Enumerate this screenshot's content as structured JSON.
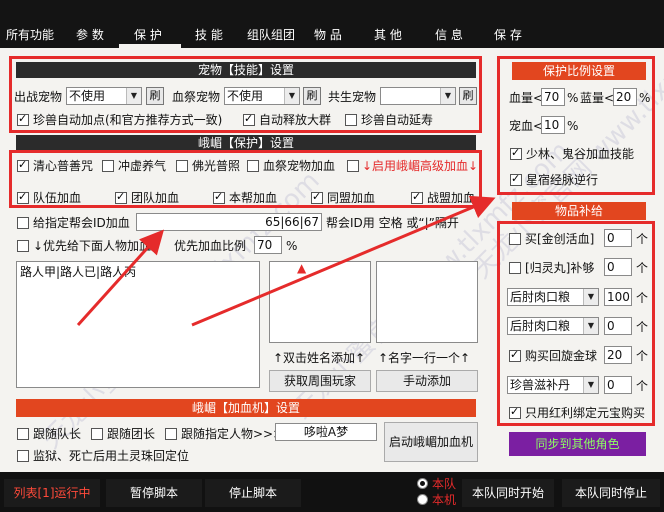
{
  "tabs": [
    "所有功能",
    "参 数",
    "保 护",
    "技 能",
    "组队组团",
    "物 品",
    "其 他",
    "信 息",
    "保 存"
  ],
  "pet": {
    "header": "宠物【技能】设置",
    "out_pet_label": "出战宠物",
    "out_pet_value": "不使用",
    "blood_pet_label": "血祭宠物",
    "blood_pet_value": "不使用",
    "cogen_pet_label": "共生宠物",
    "cogen_pet_value": "",
    "refresh": "刷",
    "auto_point": "珍兽自动加点(和官方推荐方式一致)",
    "auto_release": "自动释放大群",
    "auto_extend": "珍兽自动延寿"
  },
  "protect": {
    "header": "峨嵋【保护】设置",
    "qingxin": "清心普善咒",
    "chongxu": "冲虚养气",
    "foguang": "佛光普照",
    "blood_pet_heal": "血祭宠物加血",
    "advanced_heal": "↓启用峨嵋高级加血↓",
    "team_heal": "队伍加血",
    "group_heal": "团队加血",
    "guild_heal": "本帮加血",
    "league_heal": "同盟加血",
    "war_league_heal": "战盟加血",
    "specify_guild_id": "给指定帮会ID加血",
    "guild_ids": "65|66|67",
    "guild_id_sep": "帮会ID用 空格 或“|”隔开",
    "priority_below": "↓优先给下面人物加血↓",
    "priority_ratio_label": "优先加血比例",
    "priority_ratio": "70",
    "percent": "%",
    "priority_list": "路人甲|路人已|路人丙",
    "dbl_click_hint": "↑双击姓名添加↑",
    "one_per_line_hint": "↑名字一行一个↑",
    "get_nearby_btn": "获取周围玩家",
    "manual_add_btn": "手动添加"
  },
  "machine": {
    "header": "峨嵋【加血机】设置",
    "follow_leader": "跟随队长",
    "follow_group_leader": "跟随团长",
    "follow_person": "跟随指定人物>>>",
    "person_name": "哆啦A梦",
    "start_btn": "启动峨嵋加血机",
    "return_on_death": "监狱、死亡后用土灵珠回定位"
  },
  "ratio": {
    "header": "保护比例设置",
    "hp_label": "血量<",
    "hp_value": "70",
    "mp_label": "蓝量<",
    "mp_value": "20",
    "pet_label": "宠血<",
    "pet_value": "10",
    "percent": "%",
    "shaolin": "少林、鬼谷加血技能",
    "xingxiu": "星宿经脉逆行"
  },
  "supply": {
    "header": "物品补给",
    "buy_label": "买[金创活血]",
    "buy_qty": "0",
    "gui_label": "[归灵丸]补够",
    "gui_qty": "0",
    "item1": "后肘肉口粮",
    "item1_qty": "100",
    "item2": "后肘肉口粮",
    "item2_qty": "0",
    "buy_huixuan": "购买回旋金球",
    "huixuan_qty": "20",
    "item3": "珍兽滋补丹",
    "item3_qty": "0",
    "unit": "个",
    "bound_only": "只用红利绑定元宝购买",
    "sync_btn": "同步到其他角色"
  },
  "bottom": {
    "list_status": "列表[1]运行中",
    "pause_btn": "暂停脚本",
    "stop_btn": "停止脚本",
    "radio_team": "本队",
    "radio_self": "本机",
    "team_start_btn": "本队同时开始",
    "team_stop_btn": "本队同时停止"
  },
  "colors": {
    "accent_red": "#e52b2b",
    "header_orange": "#e2461f",
    "sync_purple": "#7b1fa2",
    "sync_text": "#8cff62"
  }
}
